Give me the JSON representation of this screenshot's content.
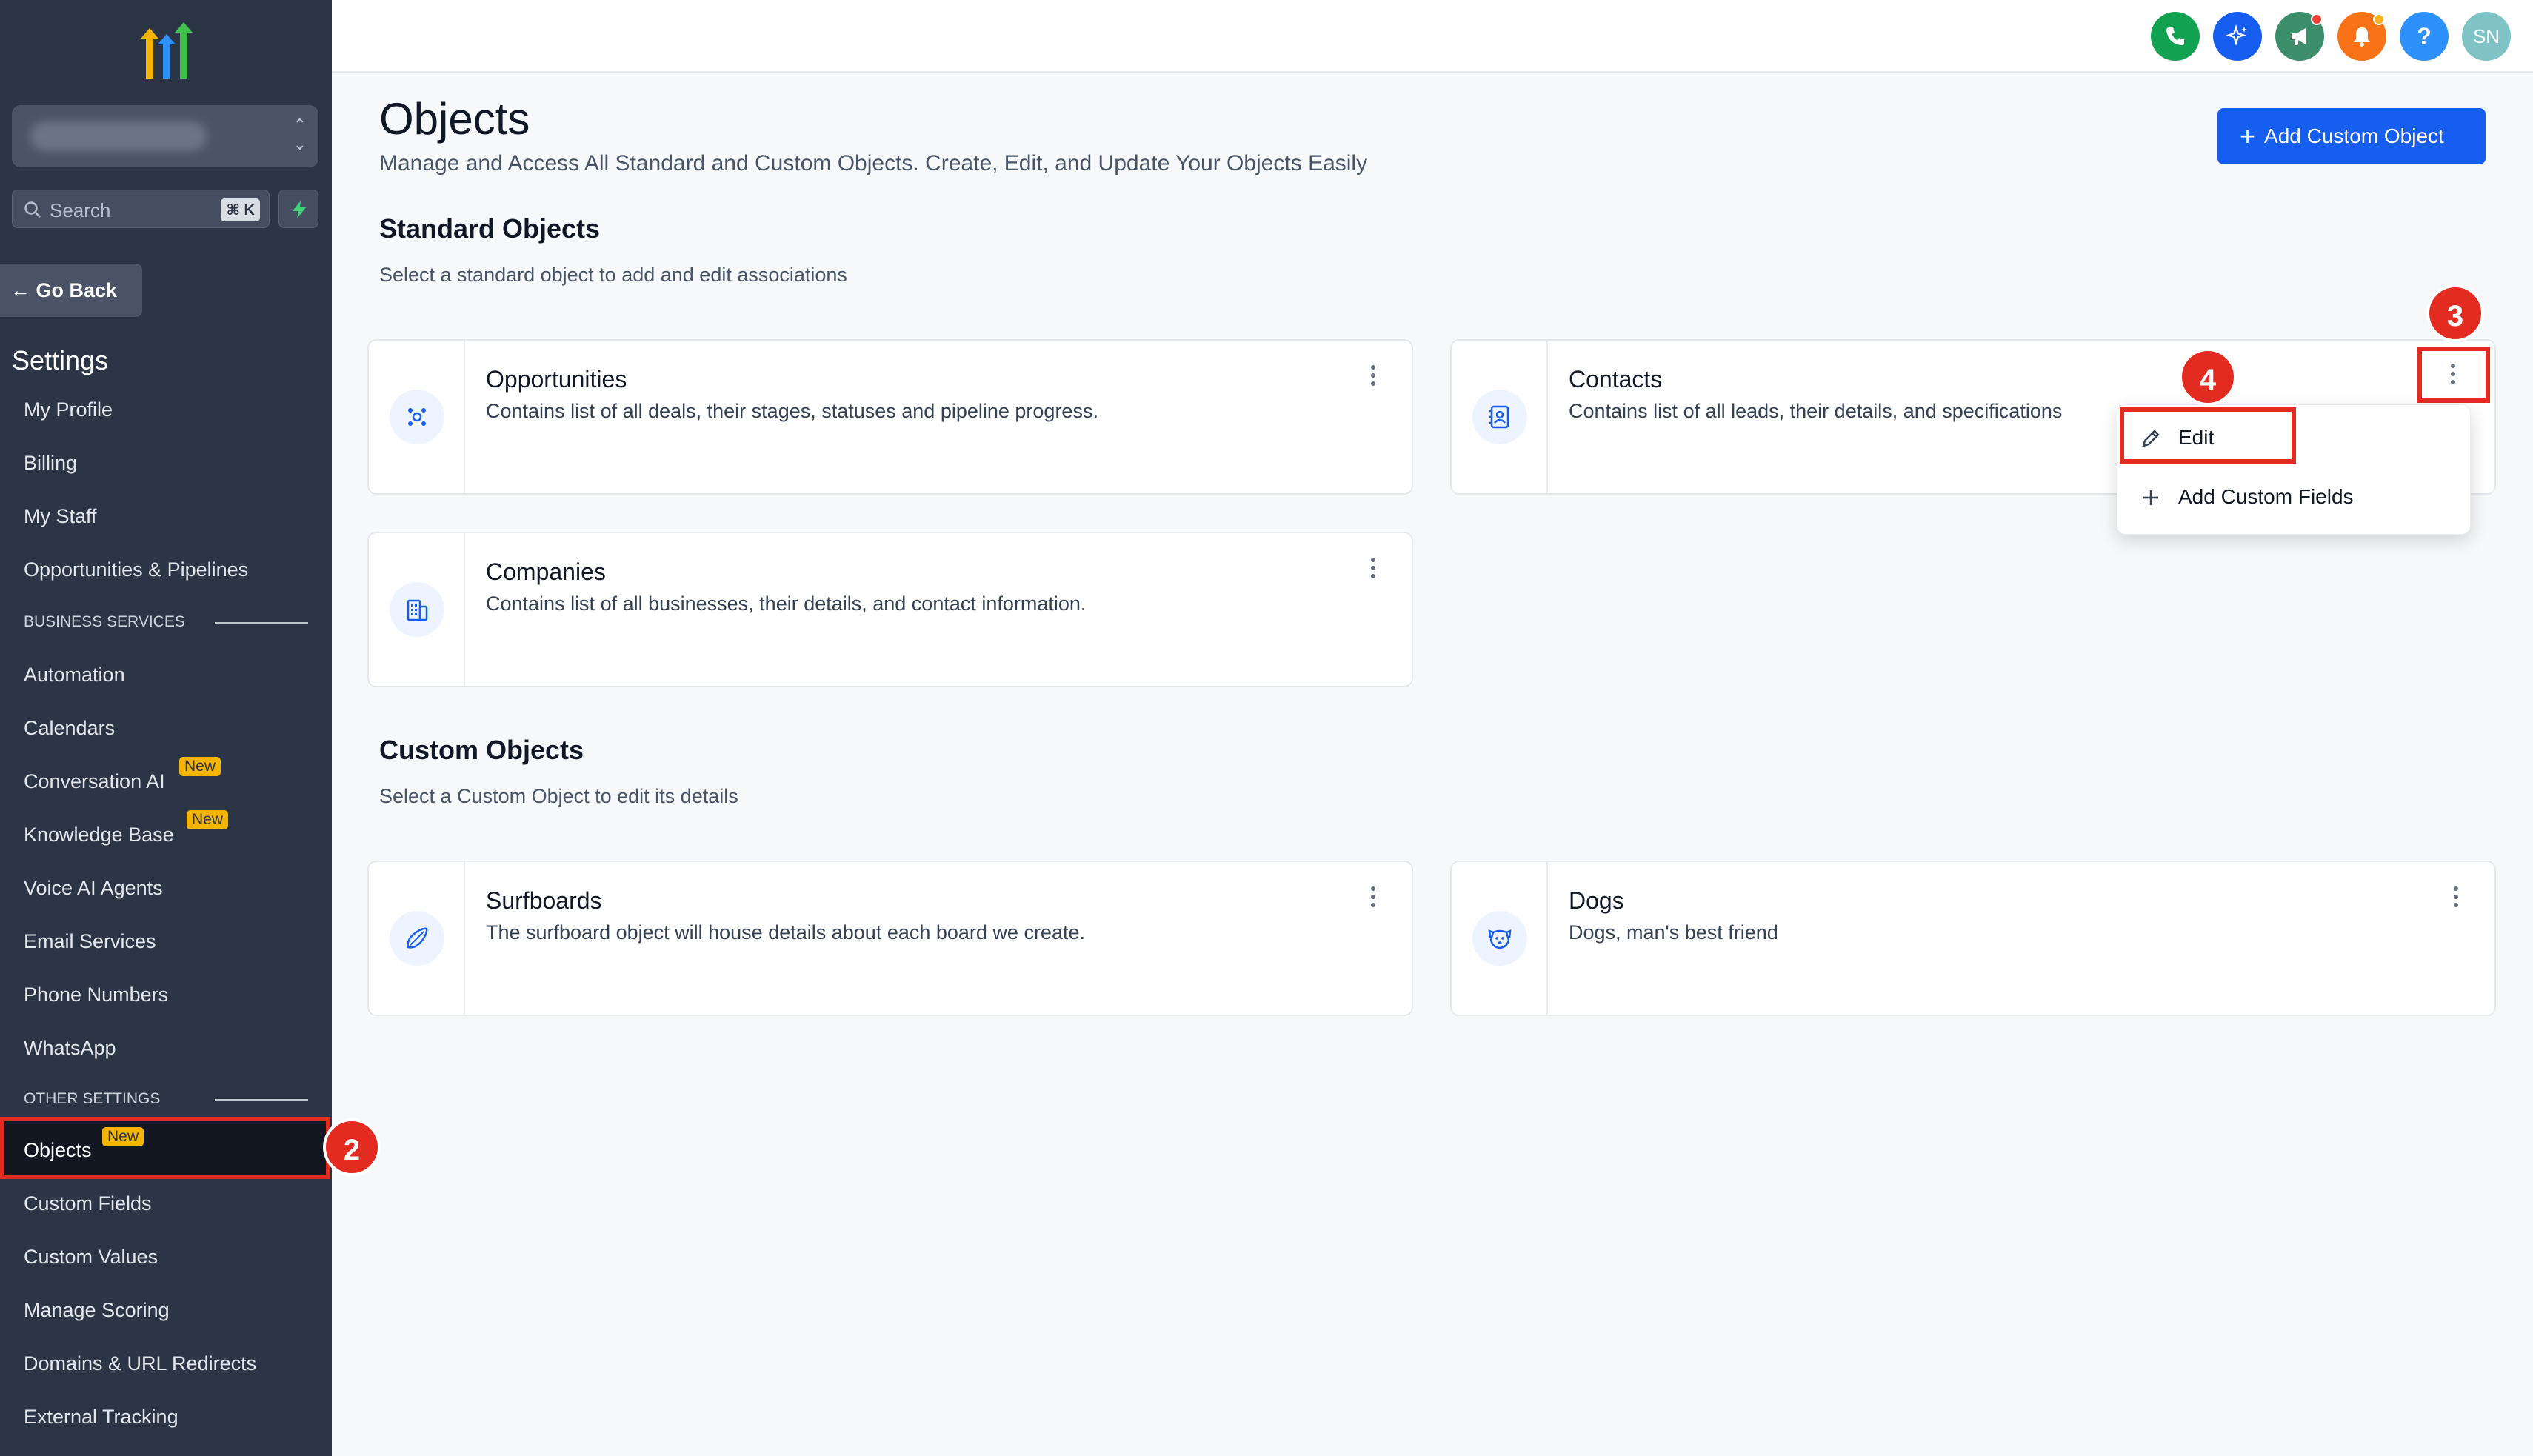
{
  "sidebar": {
    "search_label": "Search",
    "search_shortcut": "⌘ K",
    "go_back": "← Go Back",
    "settings_title": "Settings",
    "items": {
      "my_profile": "My Profile",
      "billing": "Billing",
      "my_staff": "My Staff",
      "opportunities_pipelines": "Opportunities & Pipelines",
      "automation": "Automation",
      "calendars": "Calendars",
      "conversation_ai": "Conversation AI",
      "knowledge_base": "Knowledge Base",
      "voice_ai_agents": "Voice AI Agents",
      "email_services": "Email Services",
      "phone_numbers": "Phone Numbers",
      "whatsapp": "WhatsApp",
      "objects": "Objects",
      "custom_fields": "Custom Fields",
      "custom_values": "Custom Values",
      "manage_scoring": "Manage Scoring",
      "domains_redirects": "Domains & URL Redirects",
      "external_tracking": "External Tracking"
    },
    "sections": {
      "business_services": "BUSINESS SERVICES",
      "other_settings": "OTHER SETTINGS"
    },
    "badge_new": "New"
  },
  "topbar": {
    "avatar_initials": "SN",
    "help_glyph": "?",
    "icons": [
      "phone-icon",
      "sparkle-icon",
      "megaphone-icon",
      "bell-icon",
      "help-icon"
    ],
    "colors": {
      "phone": "#12a150",
      "sparkle": "#155eef",
      "megaphone": "#3d8f6b",
      "bell": "#f97316",
      "help": "#2e90fa"
    }
  },
  "main": {
    "title": "Objects",
    "subtitle": "Manage and Access All Standard and Custom Objects. Create, Edit, and Update Your Objects Easily",
    "add_button": "Add Custom Object",
    "standard": {
      "title": "Standard Objects",
      "subtitle": "Select a standard object to add and edit associations",
      "cards": [
        {
          "title": "Opportunities",
          "desc": "Contains list of all deals, their stages, statuses and pipeline progress.",
          "icon": "opportunities-icon"
        },
        {
          "title": "Contacts",
          "desc": "Contains list of all leads, their details, and specifications",
          "icon": "contacts-icon"
        },
        {
          "title": "Companies",
          "desc": "Contains list of all businesses, their details, and contact information.",
          "icon": "companies-icon"
        }
      ]
    },
    "custom": {
      "title": "Custom Objects",
      "subtitle": "Select a Custom Object to edit its details",
      "cards": [
        {
          "title": "Surfboards",
          "desc": "The surfboard object will house details about each board we create.",
          "icon": "surfboard-icon"
        },
        {
          "title": "Dogs",
          "desc": "Dogs, man's best friend",
          "icon": "dog-icon"
        }
      ]
    },
    "dropdown": {
      "edit": "Edit",
      "add_fields": "Add Custom Fields"
    }
  },
  "annotations": [
    "2",
    "3",
    "4"
  ],
  "colors": {
    "accent": "#155eef",
    "highlight": "#e32b22",
    "sidebar_bg": "#2c3546",
    "badge": "#f5b400"
  }
}
